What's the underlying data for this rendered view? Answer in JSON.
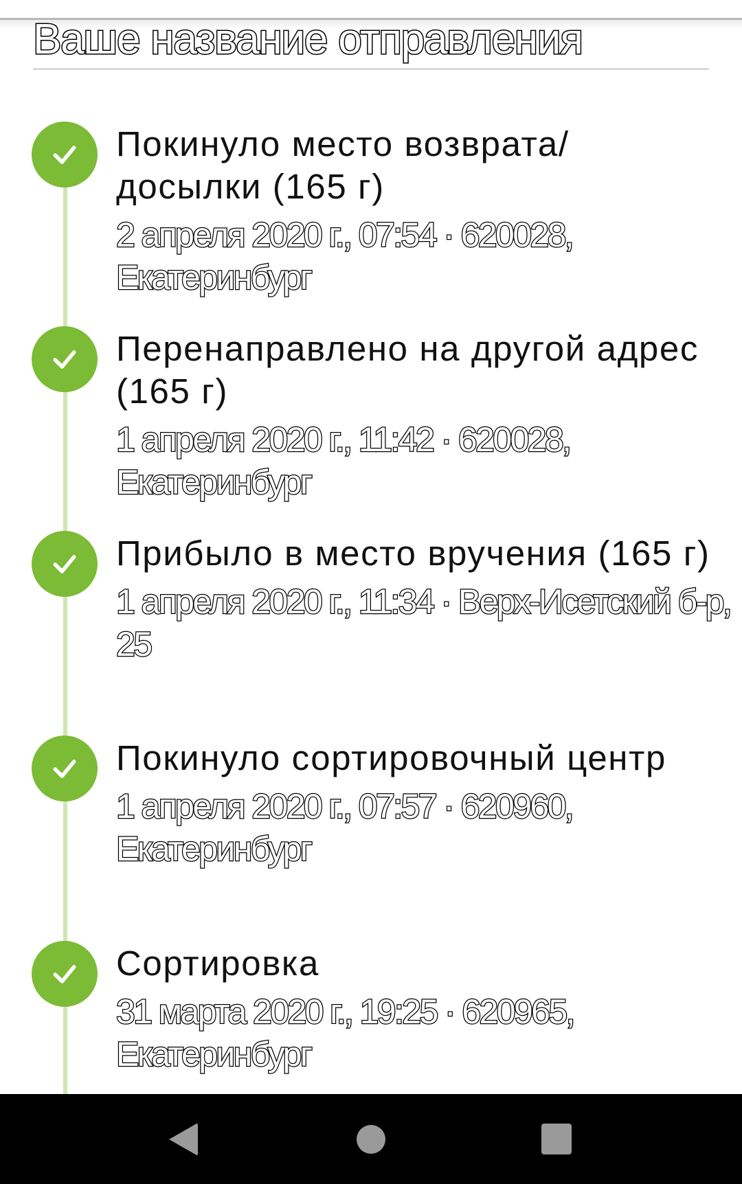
{
  "header": {
    "title": "Ваше название отправления"
  },
  "colors": {
    "status_done": "#7cbb35",
    "timeline_line": "#cfe6b3",
    "divider": "#dcdad6",
    "nav_bar": "#000000",
    "nav_icon": "#9a9a9a"
  },
  "events": [
    {
      "status_icon": "check-icon",
      "title": "Покинуло место возврата/ досылки (165 г)",
      "meta": "2 апреля 2020 г., 07:54 · 620028, Екатеринбург"
    },
    {
      "status_icon": "check-icon",
      "title": "Перенаправлено на другой адрес (165 г)",
      "meta": "1 апреля 2020 г., 11:42 · 620028, Екатеринбург"
    },
    {
      "status_icon": "check-icon",
      "title": "Прибыло в место вручения (165 г)",
      "meta": "1 апреля 2020 г., 11:34 · Верх-Исетский б-р, 25"
    },
    {
      "status_icon": "check-icon",
      "title": "Покинуло сортировочный центр",
      "meta": "1 апреля 2020 г., 07:57 · 620960, Екатеринбург"
    },
    {
      "status_icon": "check-icon",
      "title": "Сортировка",
      "meta": "31 марта 2020 г., 19:25 · 620965, Екатеринбург"
    }
  ],
  "nav": {
    "back_icon": "back-triangle-icon",
    "home_icon": "home-circle-icon",
    "recents_icon": "recents-square-icon"
  }
}
